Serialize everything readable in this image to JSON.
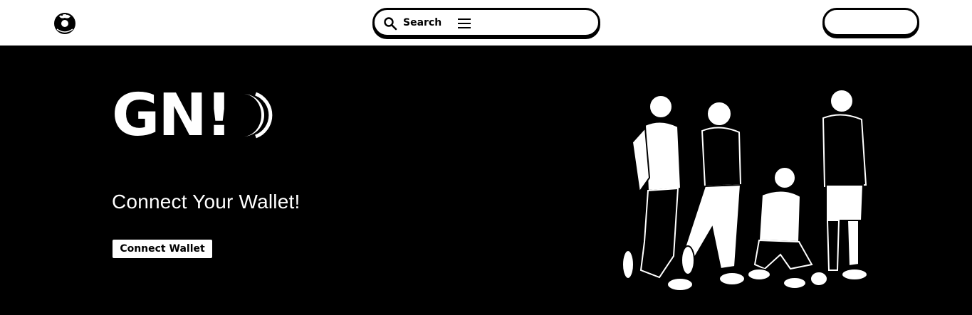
{
  "header": {
    "logo_icon": "donut-logo-icon",
    "search": {
      "icon": "search-icon",
      "label": "Search",
      "menu_icon": "hamburger-menu-icon"
    },
    "right_button_label": ""
  },
  "hero": {
    "brand_mark": "GN!",
    "title": "Connect Your Wallet!",
    "connect_button_label": "Connect Wallet",
    "illustration": "group-of-people-illustration"
  },
  "colors": {
    "background": "#000000",
    "header_background": "#ffffff",
    "text_light": "#ffffff",
    "text_dark": "#000000"
  }
}
